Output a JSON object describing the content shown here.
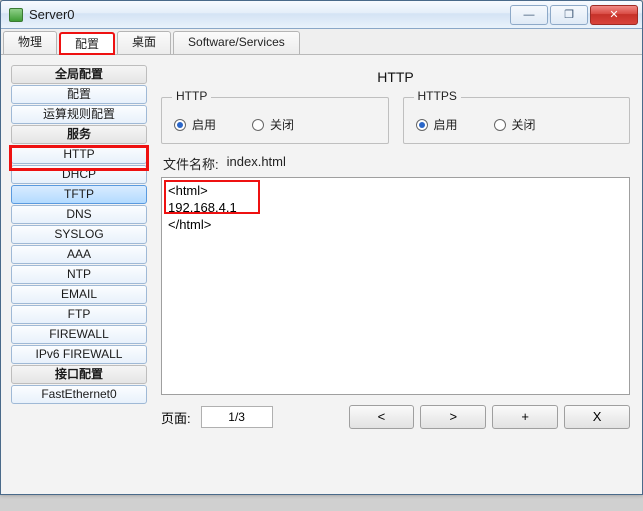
{
  "window": {
    "title": "Server0"
  },
  "winctrl": {
    "min": "—",
    "max": "❐",
    "close": "✕"
  },
  "tabs": [
    {
      "label": "物理"
    },
    {
      "label": "配置"
    },
    {
      "label": "桌面"
    },
    {
      "label": "Software/Services"
    }
  ],
  "sidebar": {
    "section_global": "全局配置",
    "btn_config": "配置",
    "btn_algo": "运算规则配置",
    "section_services": "服务",
    "svc_http": "HTTP",
    "svc_dhcp": "DHCP",
    "svc_tftp": "TFTP",
    "svc_dns": "DNS",
    "svc_syslog": "SYSLOG",
    "svc_aaa": "AAA",
    "svc_ntp": "NTP",
    "svc_email": "EMAIL",
    "svc_ftp": "FTP",
    "svc_firewall": "FIREWALL",
    "svc_ipv6fw": "IPv6 FIREWALL",
    "section_if": "接口配置",
    "if_fe0": "FastEthernet0"
  },
  "main": {
    "title": "HTTP",
    "http_box_title": "HTTP",
    "https_box_title": "HTTPS",
    "radio_on": "启用",
    "radio_off": "关闭",
    "fname_label": "文件名称:",
    "fname_value": "index.html",
    "content_l1": "<html>",
    "content_l2": "192.168.4.1",
    "content_l3": "</html>",
    "pager_label": "页面:",
    "pager_value": "1/3",
    "btn_prev": "<",
    "btn_next": ">",
    "btn_add": "+",
    "btn_del": "X"
  }
}
